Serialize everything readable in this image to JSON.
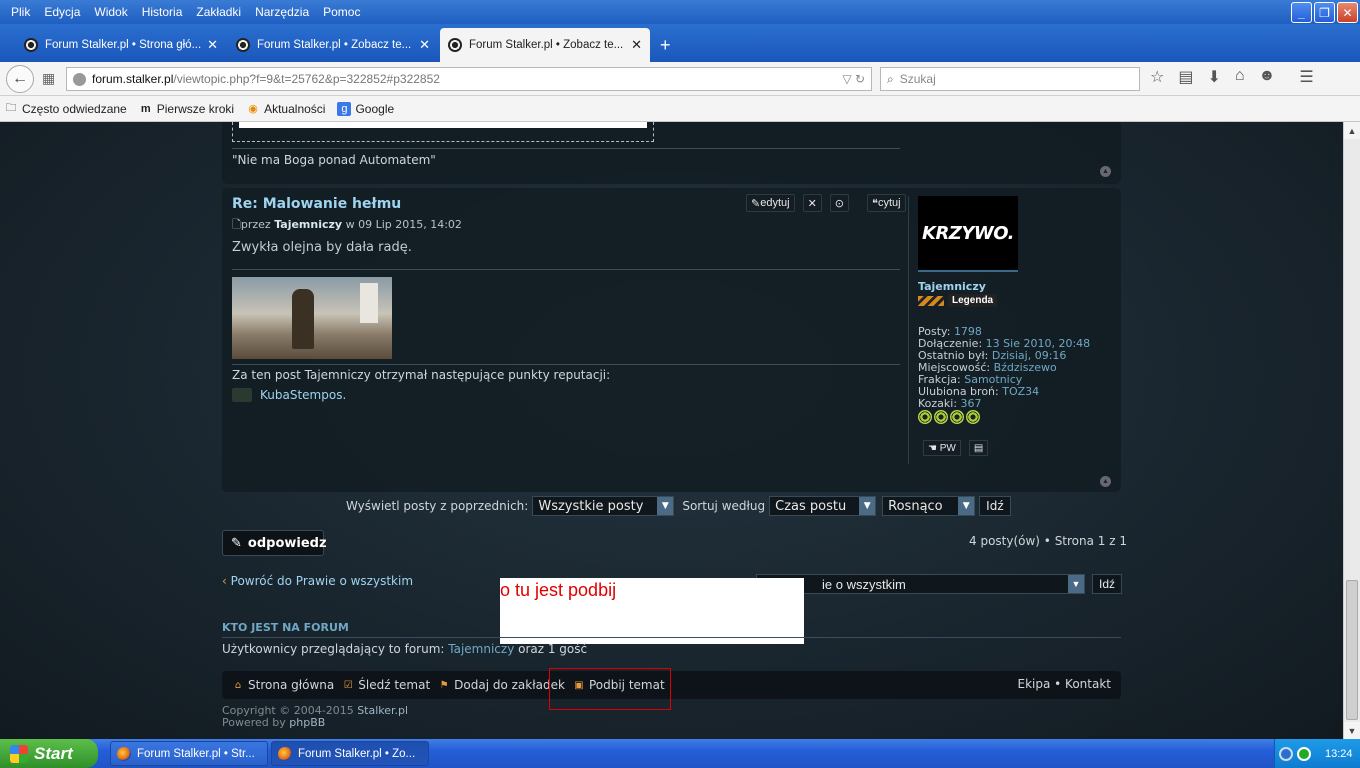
{
  "menu": [
    "Plik",
    "Edycja",
    "Widok",
    "Historia",
    "Zakładki",
    "Narzędzia",
    "Pomoc"
  ],
  "tabs": [
    {
      "title": "Forum Stalker.pl • Strona głó..."
    },
    {
      "title": "Forum Stalker.pl • Zobacz te..."
    },
    {
      "title": "Forum Stalker.pl • Zobacz te..."
    }
  ],
  "url": {
    "host": "forum.stalker.pl",
    "rest": "/viewtopic.php?f=9&t=25762&p=322852#p322852"
  },
  "search": {
    "placeholder": "Szukaj"
  },
  "bookmarks": [
    "Często odwiedzane",
    "Pierwsze kroki",
    "Aktualności",
    "Google"
  ],
  "prev_post": {
    "signature": "\"Nie ma Boga ponad Automatem\""
  },
  "post": {
    "title": "Re: Malowanie hełmu",
    "meta_by": "przez",
    "meta_author": "Tajemniczy",
    "meta_date": "w 09 Lip 2015, 14:02",
    "actions": {
      "edit": "edytuj",
      "delete": "✕",
      "info": "⊙",
      "quote": "cytuj"
    },
    "body": "Zwykła olejna by dała radę.",
    "reputation_text": "Za ten post Tajemniczy otrzymał następujące punkty reputacji:",
    "reputation_user": "KubaStempos."
  },
  "profile": {
    "avatar_text": "KRZYWO.",
    "name": "Tajemniczy",
    "rank": "Legenda",
    "stats": [
      {
        "label": "Posty:",
        "value": "1798"
      },
      {
        "label": "Dołączenie:",
        "value": "13 Sie 2010, 20:48"
      },
      {
        "label": "Ostatnio był:",
        "value": "Dzisiaj, 09:16"
      },
      {
        "label": "Miejscowość:",
        "value": "Bździszewo"
      },
      {
        "label": "Frakcja:",
        "value": "Samotnicy"
      },
      {
        "label": "Ulubiona broń:",
        "value": "TOZ34"
      },
      {
        "label": "Kozaki:",
        "value": "367"
      }
    ],
    "pm_label": "PW"
  },
  "filters": {
    "show_label": "Wyświetl posty z poprzednich:",
    "show_value": "Wszystkie posty",
    "sort_label": "Sortuj według",
    "sort_value": "Czas postu",
    "order_value": "Rosnąco",
    "go": "Idź"
  },
  "reply_label": "odpowiedz",
  "pagination": "4 posty(ów) • Strona 1 z 1",
  "back_link": "Powróć do Prawie o wszystkim",
  "jump": {
    "value": "ie o wszystkim",
    "go": "Idź"
  },
  "annotation": "o tu jest podbij",
  "who": {
    "title": "KTO JEST NA FORUM",
    "text_before": "Użytkownicy przeglądający to forum: ",
    "user": "Tajemniczy",
    "text_after": " oraz 1 gość"
  },
  "footer": {
    "items": [
      "Strona główna",
      "Śledź temat",
      "Dodaj do zakładek",
      "Podbij temat"
    ],
    "right": "Ekipa • Kontakt"
  },
  "copyright": {
    "line1_prefix": "Copyright © 2004-2015 ",
    "line1_link": "Stalker.pl",
    "line2_prefix": "Powered by ",
    "line2_link": "phpBB"
  },
  "taskbar": {
    "start": "Start",
    "tasks": [
      "Forum Stalker.pl • Str...",
      "Forum Stalker.pl • Zo..."
    ],
    "clock": "13:24"
  }
}
